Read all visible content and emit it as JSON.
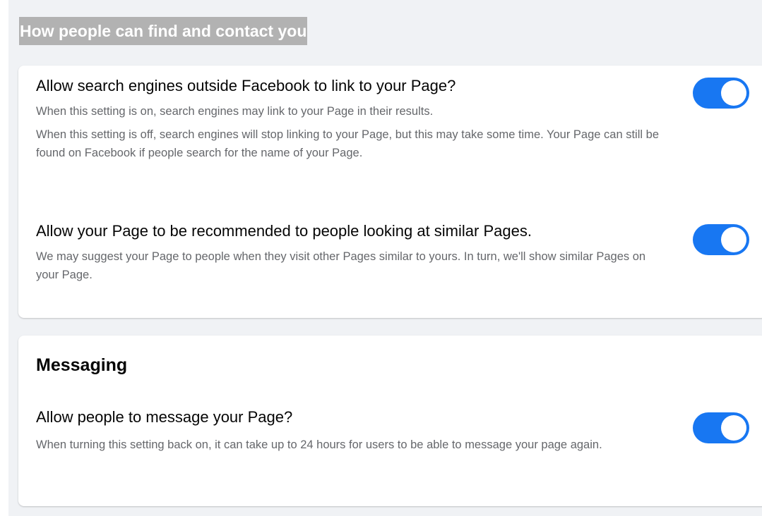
{
  "section": {
    "title": "How people can find and contact you"
  },
  "settings": {
    "search_engines": {
      "title": "Allow search engines outside Facebook to link to your Page?",
      "desc1": "When this setting is on, search engines may link to your Page in their results.",
      "desc2": "When this setting is off, search engines will stop linking to your Page, but this may take some time. Your Page can still be found on Facebook if people search for the name of your Page.",
      "enabled": true
    },
    "recommend": {
      "title": "Allow your Page to be recommended to people looking at similar Pages.",
      "desc": "We may suggest your Page to people when they visit other Pages similar to yours. In turn, we'll show similar Pages on your Page.",
      "enabled": true
    }
  },
  "messaging": {
    "heading": "Messaging",
    "allow_messages": {
      "title": "Allow people to message your Page?",
      "desc": "When turning this setting back on, it can take up to 24 hours for users to be able to message your page again.",
      "enabled": true
    }
  },
  "colors": {
    "toggle_on": "#1877f2",
    "background": "#f0f2f5",
    "secondary_text": "#65676b",
    "section_title_bg": "#b2b2b2"
  }
}
